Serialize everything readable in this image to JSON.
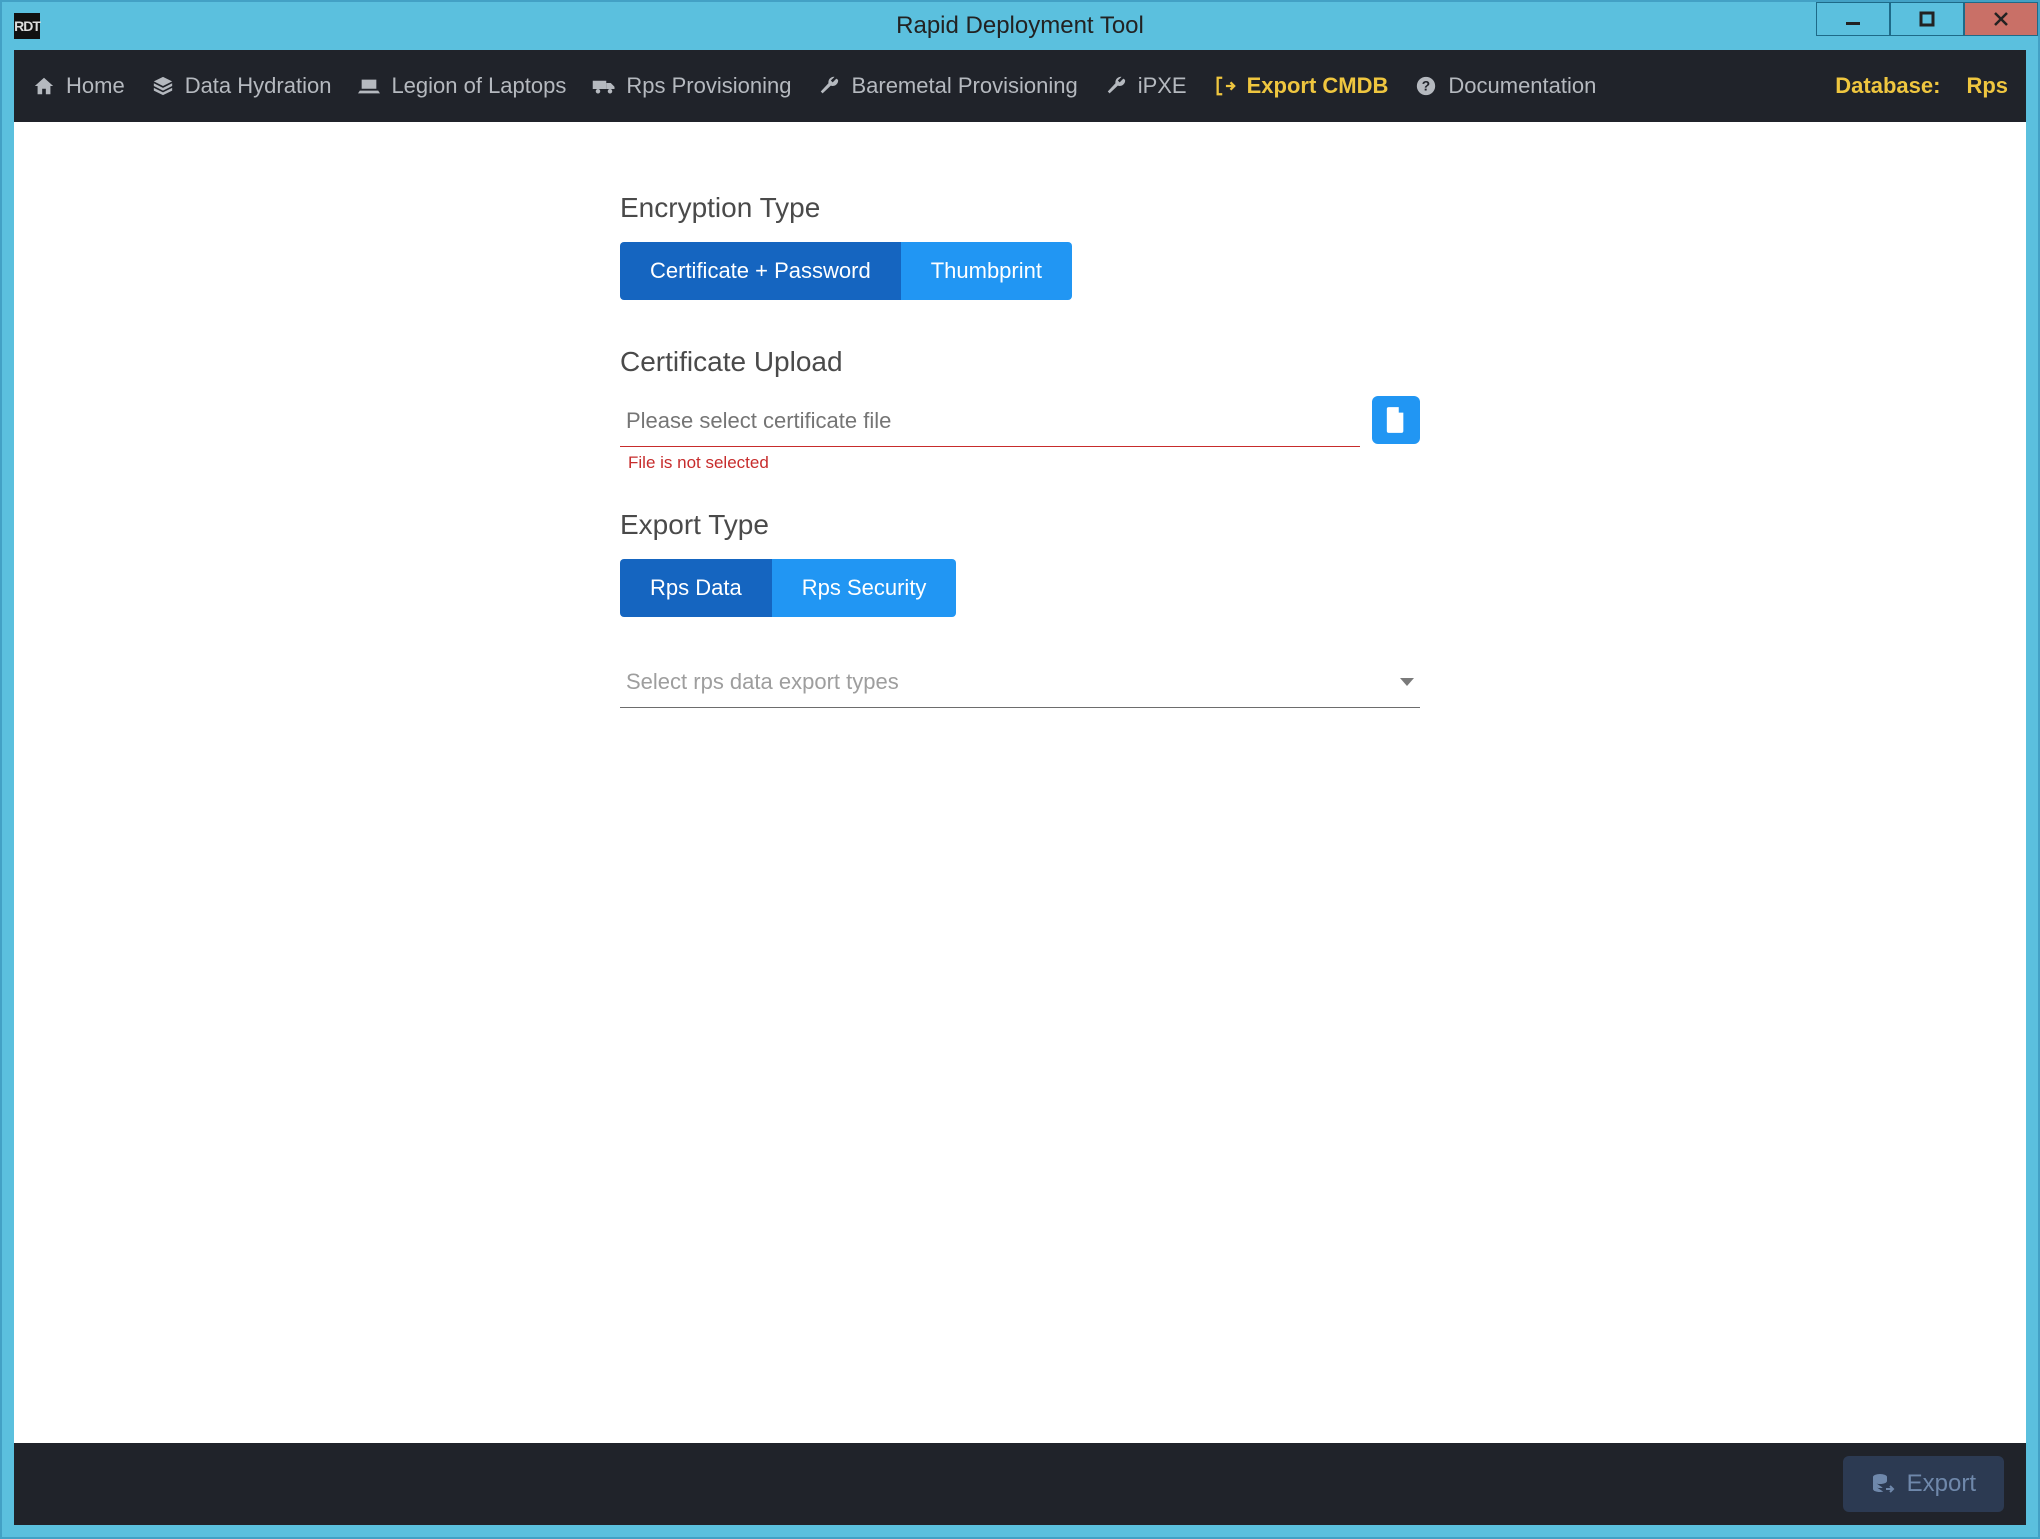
{
  "window": {
    "icon_text": "RDT",
    "title": "Rapid Deployment Tool"
  },
  "nav": {
    "items": [
      {
        "label": "Home",
        "icon": "home",
        "active": false
      },
      {
        "label": "Data Hydration",
        "icon": "layers",
        "active": false
      },
      {
        "label": "Legion of Laptops",
        "icon": "laptop",
        "active": false
      },
      {
        "label": "Rps Provisioning",
        "icon": "truck",
        "active": false
      },
      {
        "label": "Baremetal Provisioning",
        "icon": "wrench",
        "active": false
      },
      {
        "label": "iPXE",
        "icon": "wrench",
        "active": false
      },
      {
        "label": "Export CMDB",
        "icon": "export",
        "active": true
      },
      {
        "label": "Documentation",
        "icon": "help",
        "active": false
      }
    ],
    "database_label": "Database:",
    "database_value": "Rps"
  },
  "form": {
    "encryption": {
      "heading": "Encryption Type",
      "options": [
        {
          "label": "Certificate + Password",
          "selected": true
        },
        {
          "label": "Thumbprint",
          "selected": false
        }
      ]
    },
    "upload": {
      "heading": "Certificate Upload",
      "placeholder": "Please select certificate file",
      "value": "",
      "error": "File is not selected"
    },
    "export_type": {
      "heading": "Export Type",
      "options": [
        {
          "label": "Rps Data",
          "selected": true
        },
        {
          "label": "Rps Security",
          "selected": false
        }
      ],
      "select_placeholder": "Select rps data export types"
    }
  },
  "footer": {
    "export_label": "Export"
  },
  "colors": {
    "navbar_bg": "#20232a",
    "accent": "#2196f3",
    "accent_dark": "#1565c0",
    "gold": "#efc63f",
    "error": "#c72c2c",
    "titlebar": "#5bc0de"
  }
}
